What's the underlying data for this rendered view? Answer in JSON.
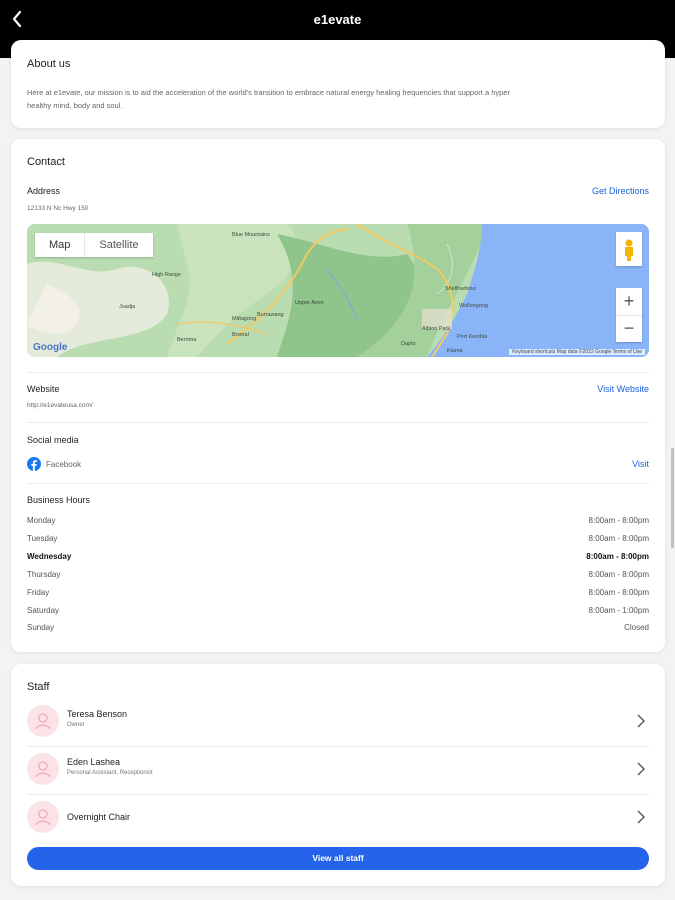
{
  "header": {
    "title": "e1evate",
    "back_icon": "chevron-left-icon"
  },
  "about": {
    "heading": "About us",
    "text_line1": "Here at e1evate, our mission is to aid the acceleration of the world's transition to embrace natural energy healing frequencies that support a hyper",
    "text_line2": "healthy mind, body and soul."
  },
  "contact": {
    "heading": "Contact",
    "address_label": "Address",
    "address_value": "12133 N Nc Hwy 150",
    "directions_link": "Get Directions",
    "map": {
      "map_tab": "Map",
      "satellite_tab": "Satellite",
      "zoom_in": "+",
      "zoom_out": "−",
      "google_logo": "Google",
      "footer": "Keyboard shortcuts    Map data ©2022 Google    Terms of Use",
      "place_labels": [
        "Blue Mountains",
        "High Range",
        "Joadja",
        "Mittagong",
        "Bowral",
        "Burrawang",
        "Upper Avon",
        "Wollongong",
        "Shellharbour",
        "Kiama",
        "Dapto",
        "Albion Park",
        "Port Kembla",
        "Berrima"
      ]
    },
    "website_label": "Website",
    "website_value": "http://e1evateusa.com/",
    "website_link": "Visit Website",
    "social_label": "Social media",
    "social_items": [
      {
        "name": "Facebook",
        "icon": "facebook-icon",
        "link": "Visit"
      }
    ],
    "hours_label": "Business Hours",
    "hours": [
      {
        "day": "Monday",
        "time": "8:00am - 8:00pm",
        "today": false
      },
      {
        "day": "Tuesday",
        "time": "8:00am - 8:00pm",
        "today": false
      },
      {
        "day": "Wednesday",
        "time": "8:00am - 8:00pm",
        "today": true
      },
      {
        "day": "Thursday",
        "time": "8:00am - 8:00pm",
        "today": false
      },
      {
        "day": "Friday",
        "time": "8:00am - 8:00pm",
        "today": false
      },
      {
        "day": "Saturday",
        "time": "8:00am - 1:00pm",
        "today": false
      },
      {
        "day": "Sunday",
        "time": "Closed",
        "today": false
      }
    ]
  },
  "staff": {
    "heading": "Staff",
    "members": [
      {
        "name": "Teresa Benson",
        "role": "Owner"
      },
      {
        "name": "Eden Lashea",
        "role": "Personal Assistant, Receptionist"
      },
      {
        "name": "Overnight Chair",
        "role": ""
      }
    ],
    "view_all": "View all staff"
  },
  "colors": {
    "accent": "#2563eb",
    "link": "#1b5fd8",
    "topbar": "#000000",
    "avatar_bg": "#fbe3e6"
  }
}
